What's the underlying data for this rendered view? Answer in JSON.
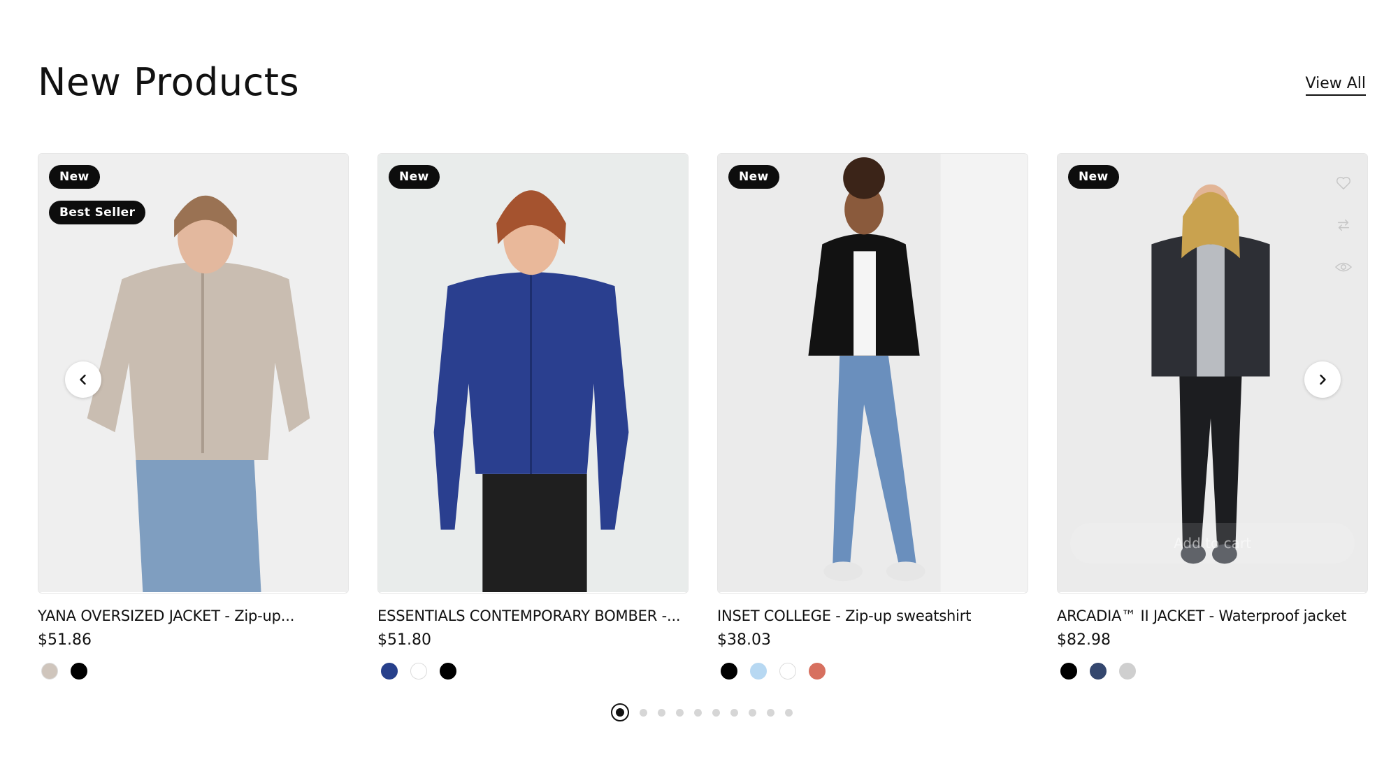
{
  "section": {
    "title": "New Products",
    "view_all": "View All"
  },
  "products": [
    {
      "name": "YANA OVERSIZED JACKET - Zip-up...",
      "price": "$51.86",
      "badges": [
        "New",
        "Best Seller"
      ],
      "colors": [
        "#cfc5bc",
        "#000000"
      ]
    },
    {
      "name": "ESSENTIALS CONTEMPORARY BOMBER -...",
      "price": "$51.80",
      "badges": [
        "New"
      ],
      "colors": [
        "#27408b",
        "#ffffff",
        "#000000"
      ]
    },
    {
      "name": "INSET COLLEGE - Zip-up sweatshirt",
      "price": "$38.03",
      "badges": [
        "New"
      ],
      "colors": [
        "#000000",
        "#b7d8f2",
        "#ffffff",
        "#d7705f"
      ]
    },
    {
      "name": "ARCADIA™ II JACKET - Waterproof jacket",
      "price": "$82.98",
      "badges": [
        "New"
      ],
      "colors": [
        "#000000",
        "#34476e",
        "#cfcfcf"
      ],
      "add_to_cart": "Add to cart"
    }
  ],
  "carousel": {
    "prev_icon": "chevron-left-icon",
    "next_icon": "chevron-right-icon",
    "pages": 10,
    "current_page": 1
  },
  "card_actions": [
    "heart-icon",
    "compare-icon",
    "eye-icon"
  ]
}
